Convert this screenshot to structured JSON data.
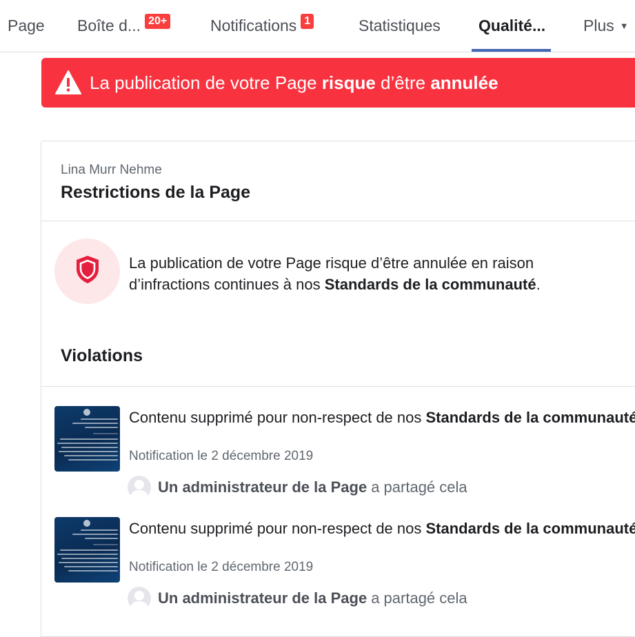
{
  "nav": {
    "tabs": [
      {
        "label": "Page"
      },
      {
        "label": "Boîte d...",
        "badge": "20+"
      },
      {
        "label": "Notifications",
        "badge": "1"
      },
      {
        "label": "Statistiques"
      },
      {
        "label": "Qualité...",
        "active": true
      },
      {
        "label": "Plus"
      }
    ]
  },
  "alert": {
    "text_part1": "La publication de votre Page ",
    "text_bold1": "risque",
    "text_part2": " d’être ",
    "text_bold2": "annulée",
    "icon": "warning-icon"
  },
  "card": {
    "page_owner": "Lina Murr Nehme",
    "title": "Restrictions de la Page",
    "restriction": {
      "icon": "shield-icon",
      "text": "La publication de votre Page risque d’être annulée en raison d’infractions continues à nos ",
      "text_bold": "Standards de la communauté",
      "text_end": "."
    },
    "violations_title": "Violations",
    "violations": [
      {
        "text": "Contenu supprimé pour non-respect de nos ",
        "text_bold": "Standards de la communauté",
        "text_end": ".",
        "date": "Notification le 2 décembre 2019",
        "shared_by": "Un administrateur de la Page",
        "shared_suffix": "a partagé cela"
      },
      {
        "text": "Contenu supprimé pour non-respect de nos ",
        "text_bold": "Standards de la communauté",
        "text_end": ".",
        "date": "Notification le 2 décembre 2019",
        "shared_by": "Un administrateur de la Page",
        "shared_suffix": "a partagé cela"
      }
    ]
  },
  "colors": {
    "alert_bg": "#f8323f",
    "accent": "#4267b2",
    "badge": "#fa3e3e",
    "shield_bg": "#fde7e8",
    "shield": "#e41e3f"
  }
}
